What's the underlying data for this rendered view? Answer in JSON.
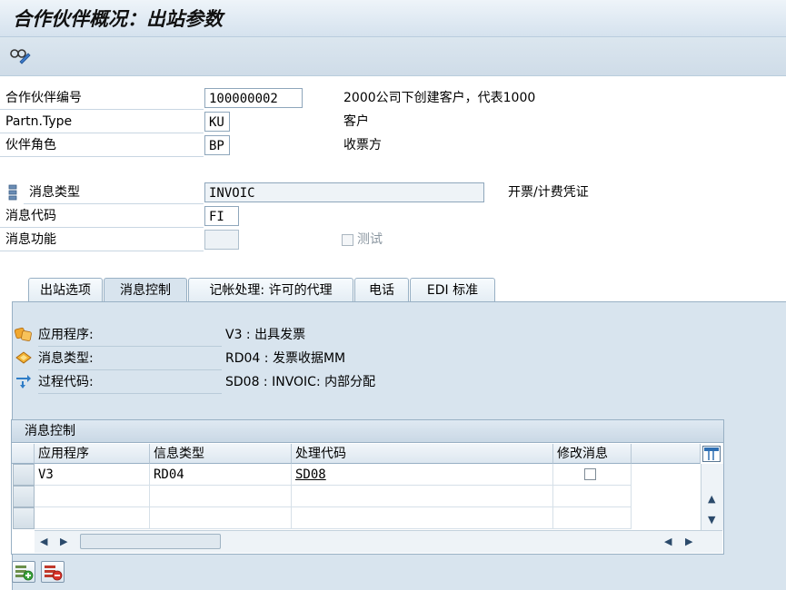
{
  "window": {
    "title": "合作伙伴概况：出站参数"
  },
  "toolbar": {
    "display_change_icon": "glasses-pencil-icon"
  },
  "header_fields": {
    "partner_no": {
      "label": "合作伙伴编号",
      "value": "100000002",
      "desc": "2000公司下创建客户，代表1000"
    },
    "partner_type": {
      "label": "Partn.Type",
      "value": "KU",
      "desc": "客户"
    },
    "partner_role": {
      "label": "伙伴角色",
      "value": "BP",
      "desc": "收票方"
    },
    "message_type": {
      "label": "消息类型",
      "value": "INVOIC",
      "desc": "开票/计费凭证"
    },
    "message_code": {
      "label": "消息代码",
      "value": "FI"
    },
    "message_function": {
      "label": "消息功能",
      "value": ""
    },
    "test": {
      "label": "测试",
      "checked": false
    }
  },
  "tabs": [
    {
      "label": "出站选项",
      "active": false
    },
    {
      "label": "消息控制",
      "active": true
    },
    {
      "label": "记帐处理: 许可的代理",
      "active": false
    },
    {
      "label": "电话",
      "active": false
    },
    {
      "label": "EDI 标准",
      "active": false
    }
  ],
  "panel": {
    "application": {
      "label": "应用程序:",
      "value": "V3 : 出具发票"
    },
    "output_type": {
      "label": "消息类型:",
      "value": "RD04 : 发票收据MM"
    },
    "process_code": {
      "label": "过程代码:",
      "value": "SD08 : INVOIC: 内部分配"
    }
  },
  "table": {
    "caption": "消息控制",
    "columns": [
      "应用程序",
      "信息类型",
      "处理代码",
      "修改消息"
    ],
    "rows": [
      {
        "application": "V3",
        "output_type": "RD04",
        "process_code": "SD08",
        "change": false
      }
    ]
  },
  "buttons": {
    "insert_row": "insert-row-icon",
    "delete_row": "delete-row-icon"
  },
  "colors": {
    "accent": "#d8e4ee",
    "title_bg": "#dfe9f1",
    "link": "#000000"
  }
}
